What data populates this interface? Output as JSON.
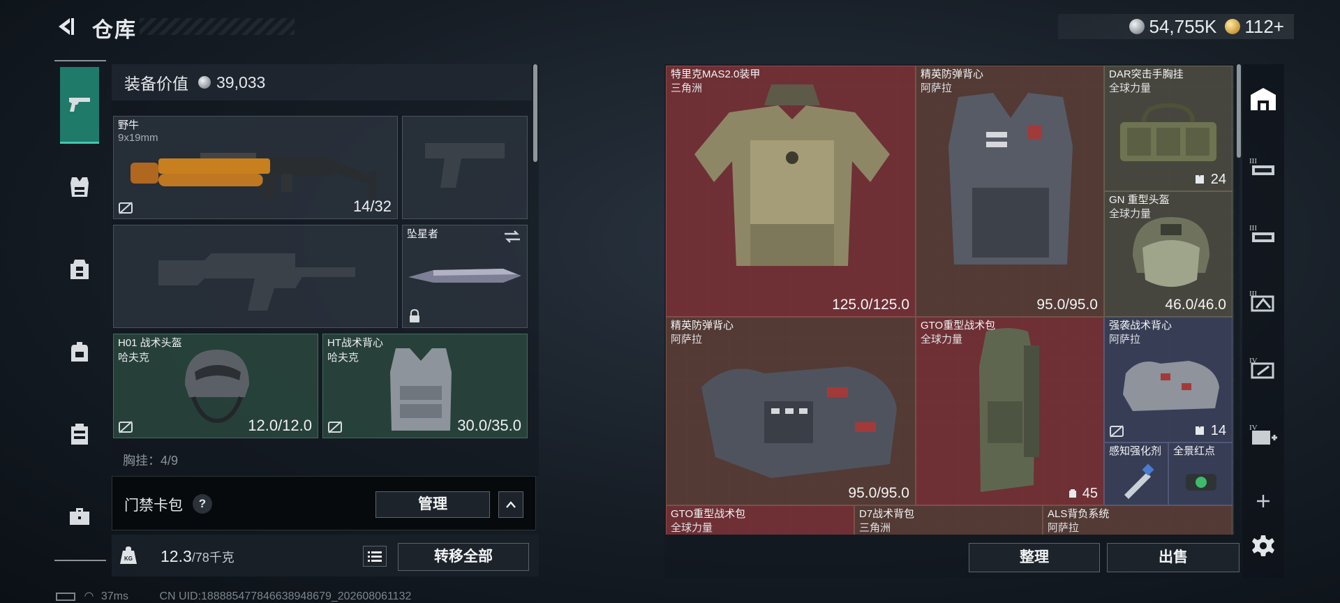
{
  "header": {
    "title": "仓库",
    "currency": [
      {
        "icon": "silver-coin-icon",
        "value": "54,755K"
      },
      {
        "icon": "gold-coin-icon",
        "value": "112+"
      }
    ]
  },
  "left_nav": {
    "items": [
      {
        "icon": "gun-icon",
        "active": true
      },
      {
        "icon": "vest-icon"
      },
      {
        "icon": "chest-rig-icon"
      },
      {
        "icon": "backpack-icon"
      },
      {
        "icon": "container-icon"
      },
      {
        "icon": "toolbox-icon"
      }
    ]
  },
  "loadout": {
    "equip_value_label": "装备价值",
    "equip_value": "39,033",
    "primary": {
      "name": "野牛",
      "ammo": "9x19mm",
      "count": "14/32"
    },
    "melee": {
      "name": "坠星者"
    },
    "helmet": {
      "name": "H01 战术头盔",
      "maker": "哈夫克",
      "durability": "12.0/12.0"
    },
    "armor": {
      "name": "HT战术背心",
      "maker": "哈夫克",
      "durability": "30.0/35.0"
    },
    "next_section_peek": "胸挂：4/9"
  },
  "keycard": {
    "label": "门禁卡包",
    "help": "?",
    "manage": "管理",
    "toggle": "^"
  },
  "weight": {
    "current": "12.3",
    "max": "/78千克"
  },
  "transfer_all": "转移全部",
  "status": {
    "ping": "37ms",
    "uid": "CN UID:1888854778466389486​79_202608061132"
  },
  "warehouse": {
    "items": [
      {
        "name": "特里克MAS2.0装甲",
        "maker": "三角洲",
        "durability": "125.0/125.0",
        "color": "red"
      },
      {
        "name": "精英防弹背心",
        "maker": "阿萨拉",
        "durability": "95.0/95.0",
        "color": "brown"
      },
      {
        "name": "DAR突击手胸挂",
        "maker": "全球力量",
        "count": "24",
        "color": "olive"
      },
      {
        "name": "GN 重型头盔",
        "maker": "全球力量",
        "durability": "46.0/46.0",
        "color": "olive"
      },
      {
        "name": "精英防弹背心",
        "maker": "阿萨拉",
        "durability": "95.0/95.0",
        "color": "brown"
      },
      {
        "name": "GTO重型战术包",
        "maker": "全球力量",
        "count": "45",
        "color": "red"
      },
      {
        "name": "强袭战术背心",
        "maker": "阿萨拉",
        "count": "14",
        "color": "blue"
      },
      {
        "name": "感知强化剂",
        "color": "blue"
      },
      {
        "name": "全景红点",
        "color": "blue"
      },
      {
        "name": "GTO重型战术包",
        "maker": "全球力量",
        "color": "red"
      },
      {
        "name": "D7战术背包",
        "maker": "三角洲",
        "color": "brown"
      },
      {
        "name": "ALS背负系统",
        "maker": "阿萨拉",
        "color": "brown"
      }
    ],
    "sort": "整理",
    "sell": "出售"
  },
  "right_nav": {
    "items": [
      {
        "icon": "warehouse-icon",
        "active": true
      },
      {
        "icon": "storage-tier-3a-icon"
      },
      {
        "icon": "storage-tier-3b-icon"
      },
      {
        "icon": "storage-tier-3c-icon"
      },
      {
        "icon": "storage-tier-4a-icon"
      },
      {
        "icon": "storage-tier-4b-icon"
      },
      {
        "icon": "add-icon"
      },
      {
        "icon": "settings-icon"
      }
    ]
  }
}
